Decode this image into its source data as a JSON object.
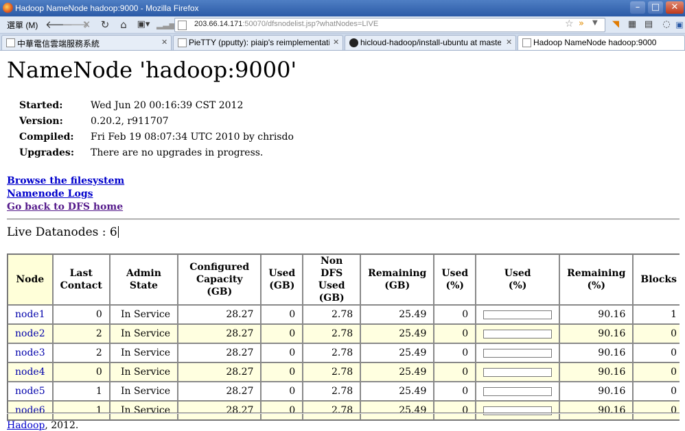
{
  "window": {
    "title": "Hadoop NameNode hadoop:9000 - Mozilla Firefox"
  },
  "toolbar": {
    "menu_label": "選單 (M)",
    "address": {
      "host": "203.66.14.171",
      "rest": ":50070/dfsnodelist.jsp?whatNodes=LIVE"
    }
  },
  "tabs": [
    {
      "label": "中華電信雲端服務系統",
      "active": false,
      "icon": "page-icon"
    },
    {
      "label": "PieTTY (pputty): piaip's reimplementatio···",
      "active": false,
      "icon": "page-icon"
    },
    {
      "label": "hicloud-hadoop/install-ubuntu at master ···",
      "active": false,
      "icon": "github-icon"
    },
    {
      "label": "Hadoop NameNode hadoop:9000",
      "active": true,
      "icon": "page-icon"
    }
  ],
  "page": {
    "heading": "NameNode 'hadoop:9000'",
    "info": [
      {
        "label": "Started:",
        "value": "Wed Jun 20 00:16:39 CST 2012"
      },
      {
        "label": "Version:",
        "value": "0.20.2, r911707"
      },
      {
        "label": "Compiled:",
        "value": "Fri Feb 19 08:07:34 UTC 2010 by chrisdo"
      },
      {
        "label": "Upgrades:",
        "value": "There are no upgrades in progress."
      }
    ],
    "links": {
      "browse": "Browse the filesystem",
      "logs": "Namenode Logs",
      "home": "Go back to DFS home"
    },
    "live_label": "Live Datanodes : 6",
    "footer": {
      "link": "Hadoop",
      "text": ", 2012."
    }
  },
  "table": {
    "headers": {
      "node": "Node",
      "last_contact_1": "Last",
      "last_contact_2": "Contact",
      "admin_state": "Admin State",
      "configured_1": "Configured",
      "configured_2": "Capacity (GB)",
      "used_1": "Used",
      "used_2": "(GB)",
      "nondfs_1": "Non DFS",
      "nondfs_2": "Used (GB)",
      "remaining_1": "Remaining",
      "remaining_2": "(GB)",
      "usedpct_1": "Used",
      "usedpct_2": "(%)",
      "usedbar_1": "Used",
      "usedbar_2": "(%)",
      "rempct_1": "Remaining",
      "rempct_2": "(%)",
      "blocks": "Blocks"
    },
    "rows": [
      {
        "node": "node1",
        "last_contact": "0",
        "admin_state": "In Service",
        "configured": "28.27",
        "used": "0",
        "non_dfs": "2.78",
        "remaining": "25.49",
        "used_pct": "0",
        "used_fraction": 0,
        "remaining_pct": "90.16",
        "blocks": "1"
      },
      {
        "node": "node2",
        "last_contact": "2",
        "admin_state": "In Service",
        "configured": "28.27",
        "used": "0",
        "non_dfs": "2.78",
        "remaining": "25.49",
        "used_pct": "0",
        "used_fraction": 0,
        "remaining_pct": "90.16",
        "blocks": "0"
      },
      {
        "node": "node3",
        "last_contact": "2",
        "admin_state": "In Service",
        "configured": "28.27",
        "used": "0",
        "non_dfs": "2.78",
        "remaining": "25.49",
        "used_pct": "0",
        "used_fraction": 0,
        "remaining_pct": "90.16",
        "blocks": "0"
      },
      {
        "node": "node4",
        "last_contact": "0",
        "admin_state": "In Service",
        "configured": "28.27",
        "used": "0",
        "non_dfs": "2.78",
        "remaining": "25.49",
        "used_pct": "0",
        "used_fraction": 0,
        "remaining_pct": "90.16",
        "blocks": "0"
      },
      {
        "node": "node5",
        "last_contact": "1",
        "admin_state": "In Service",
        "configured": "28.27",
        "used": "0",
        "non_dfs": "2.78",
        "remaining": "25.49",
        "used_pct": "0",
        "used_fraction": 0,
        "remaining_pct": "90.16",
        "blocks": "0"
      },
      {
        "node": "node6",
        "last_contact": "1",
        "admin_state": "In Service",
        "configured": "28.27",
        "used": "0",
        "non_dfs": "2.78",
        "remaining": "25.49",
        "used_pct": "0",
        "used_fraction": 0,
        "remaining_pct": "90.16",
        "blocks": "0"
      }
    ]
  }
}
